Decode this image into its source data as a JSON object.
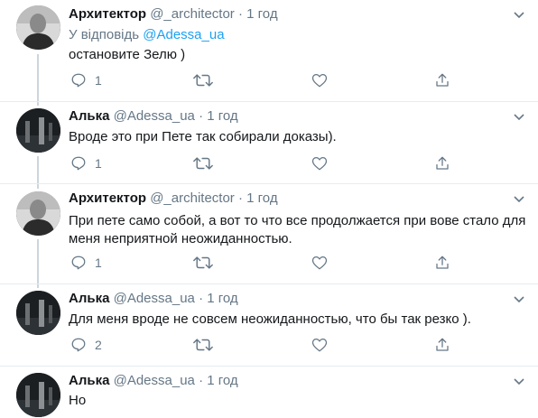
{
  "tweets": [
    {
      "name": "Архитектор",
      "handle": "@_architector",
      "dot": "·",
      "time": "1 год",
      "reply_prefix": "У відповідь",
      "reply_mention": "@Adessa_ua",
      "text": "остановите Зелю )",
      "reply_count": "1",
      "avatar_icon": "avatar-photo-man"
    },
    {
      "name": "Алька",
      "handle": "@Adessa_ua",
      "dot": "·",
      "time": "1 год",
      "text": "Вроде это при Пете так собирали доказы).",
      "reply_count": "1",
      "avatar_icon": "avatar-photo-dark"
    },
    {
      "name": "Архитектор",
      "handle": "@_architector",
      "dot": "·",
      "time": "1 год",
      "text": "При пете само собой, а вот то что все продолжается при вове стало для меня неприятной неожиданностью.",
      "reply_count": "1",
      "avatar_icon": "avatar-photo-man"
    },
    {
      "name": "Алька",
      "handle": "@Adessa_ua",
      "dot": "·",
      "time": "1 год",
      "text": "Для меня вроде не совсем неожиданностью, что бы так резко ).",
      "reply_count": "2",
      "avatar_icon": "avatar-photo-dark"
    },
    {
      "name": "Алька",
      "handle": "@Adessa_ua",
      "dot": "·",
      "time": "1 год",
      "text": "Но",
      "avatar_icon": "avatar-photo-dark"
    }
  ],
  "icons": {
    "reply": "reply-icon",
    "retweet": "retweet-icon",
    "like": "heart-icon",
    "share": "share-icon",
    "more": "chevron-down-icon"
  },
  "colors": {
    "link": "#1da1f2",
    "secondary_text": "#657786",
    "separator": "#e6ecf0",
    "thread_line": "#ccd6dd"
  }
}
